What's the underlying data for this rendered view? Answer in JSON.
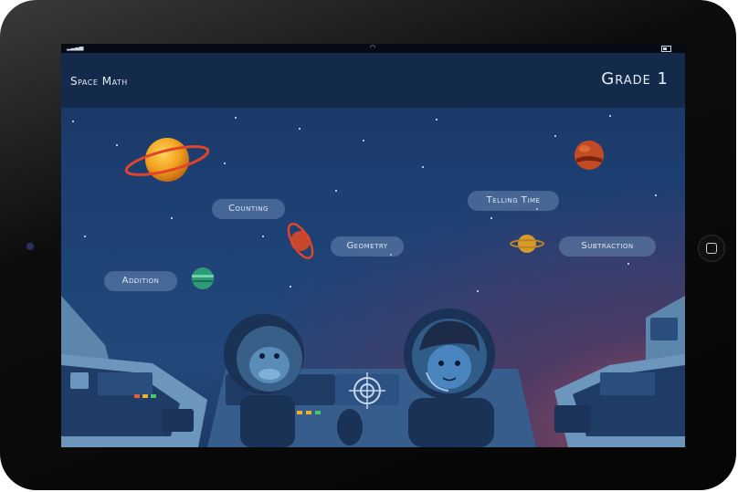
{
  "app": {
    "title": "Space Math",
    "grade": "Grade 1"
  },
  "topics": [
    {
      "id": "counting",
      "label": "Counting"
    },
    {
      "id": "telling-time",
      "label": "Telling Time"
    },
    {
      "id": "geometry",
      "label": "Geometry"
    },
    {
      "id": "subtraction",
      "label": "Subtraction"
    },
    {
      "id": "addition",
      "label": "Addition"
    }
  ],
  "icons": {
    "status": [
      "signal-icon",
      "wifi-icon",
      "battery-icon"
    ],
    "device": [
      "camera-icon",
      "home-button-icon"
    ]
  },
  "colors": {
    "header_bg": "#142a4a",
    "space_bg": "#1e4276",
    "button_bg": "#7896be",
    "planet_orange": "#f0a020",
    "ring_red": "#e0452a"
  }
}
